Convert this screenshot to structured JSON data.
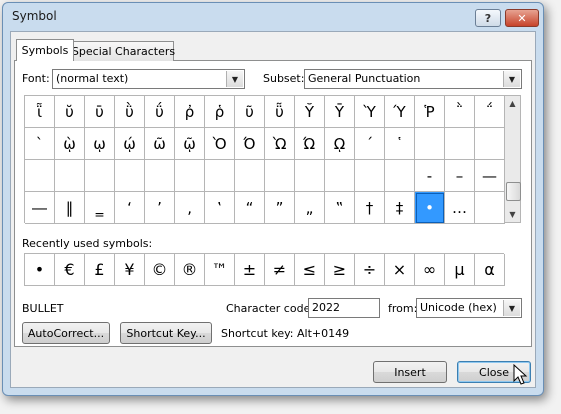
{
  "window": {
    "title": "Symbol",
    "help_label": "?",
    "close_label": "✕"
  },
  "tabs": [
    {
      "label": "Symbols",
      "underline": "S",
      "active": true
    },
    {
      "label": "Special Characters",
      "underline": "P",
      "active": false
    }
  ],
  "font": {
    "label": "Font:",
    "value": "(normal text)"
  },
  "subset": {
    "label": "Subset:",
    "value": "General Punctuation"
  },
  "grid": {
    "rows": [
      [
        "ῗ",
        "ῠ",
        "ῡ",
        "ῢ",
        "ΰ",
        "ῤ",
        "ῥ",
        "ῦ",
        "ῧ",
        "Ῠ",
        "Ῡ",
        "Ὺ",
        "Ύ",
        "Ῥ",
        "῭",
        "΅"
      ],
      [
        "`",
        "ῲ",
        "ῳ",
        "ῴ",
        "ῶ",
        "ῷ",
        "Ὸ",
        "Ό",
        "Ὼ",
        "Ώ",
        "ῼ",
        "´",
        "῾",
        "",
        "",
        ""
      ],
      [
        "",
        "",
        "",
        "",
        "",
        "",
        "",
        "",
        "",
        "",
        "",
        "",
        "",
        "‐",
        "–",
        "—"
      ],
      [
        "―",
        "‖",
        "‗",
        "‘",
        "’",
        "‚",
        "‛",
        "“",
        "”",
        "„",
        "‟",
        "†",
        "‡",
        "•",
        "…",
        ""
      ]
    ],
    "selected": {
      "row": 3,
      "col": 13
    }
  },
  "recent": {
    "label": "Recently used symbols:",
    "symbols": [
      "•",
      "€",
      "£",
      "¥",
      "©",
      "®",
      "™",
      "±",
      "≠",
      "≤",
      "≥",
      "÷",
      "×",
      "∞",
      "µ",
      "α"
    ]
  },
  "char_name": "BULLET",
  "char_code": {
    "label": "Character code:",
    "value": "2022"
  },
  "from": {
    "label": "from:",
    "value": "Unicode (hex)"
  },
  "buttons": {
    "autocorrect": "AutoCorrect...",
    "shortcut_key": "Shortcut Key...",
    "insert": "Insert",
    "close": "Close"
  },
  "shortcut_text": "Shortcut key: Alt+0149"
}
